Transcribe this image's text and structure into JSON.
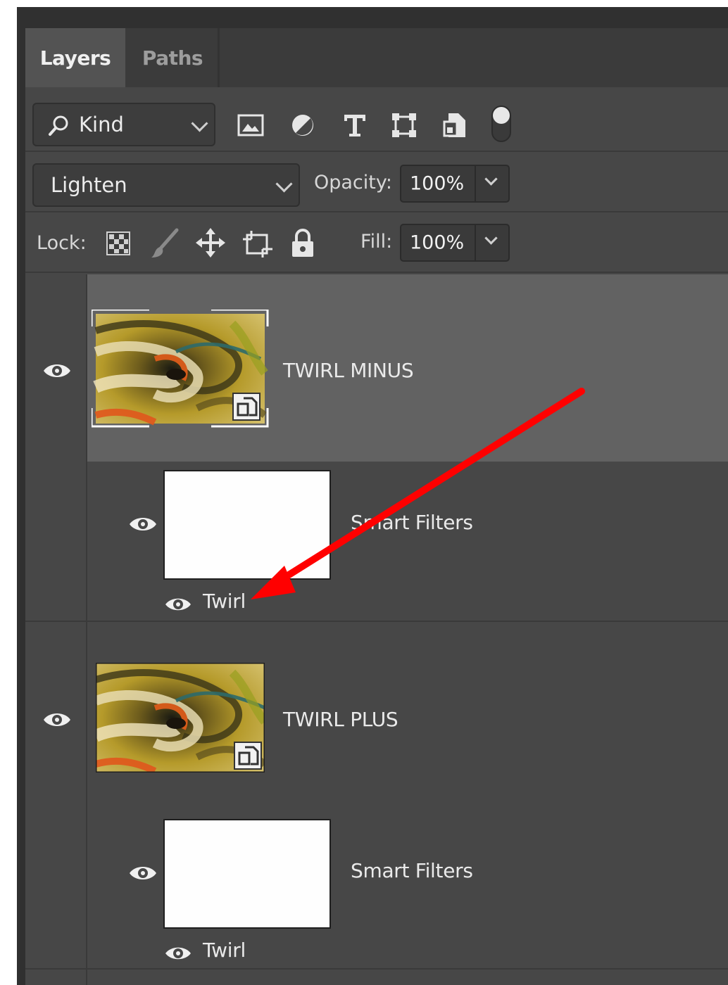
{
  "tabs": [
    {
      "label": "Layers",
      "active": true
    },
    {
      "label": "Paths",
      "active": false
    }
  ],
  "filter": {
    "kind_label": "Kind",
    "icons": [
      "image-filter-icon",
      "adjustment-filter-icon",
      "type-filter-icon",
      "shape-filter-icon",
      "smart-object-filter-icon",
      "filter-toggle-icon"
    ]
  },
  "blend": {
    "mode": "Lighten",
    "opacity_label": "Opacity:",
    "opacity_value": "100%"
  },
  "lock": {
    "label": "Lock:",
    "icons": [
      "lock-transparency-icon",
      "lock-pixels-icon",
      "lock-position-icon",
      "lock-artboard-icon",
      "lock-all-icon"
    ],
    "fill_label": "Fill:",
    "fill_value": "100%"
  },
  "layers": [
    {
      "name": "TWIRL MINUS",
      "selected": true,
      "visible": true,
      "smart_filters_label": "Smart Filters",
      "filter_name": "Twirl"
    },
    {
      "name": "TWIRL PLUS",
      "selected": false,
      "visible": true,
      "smart_filters_label": "Smart Filters",
      "filter_name": "Twirl"
    }
  ],
  "annotation": {
    "color": "#ff0000",
    "type": "arrow"
  },
  "colors": {
    "panel_bg": "#474747",
    "selected_layer": "#626262",
    "frame": "#303030"
  }
}
